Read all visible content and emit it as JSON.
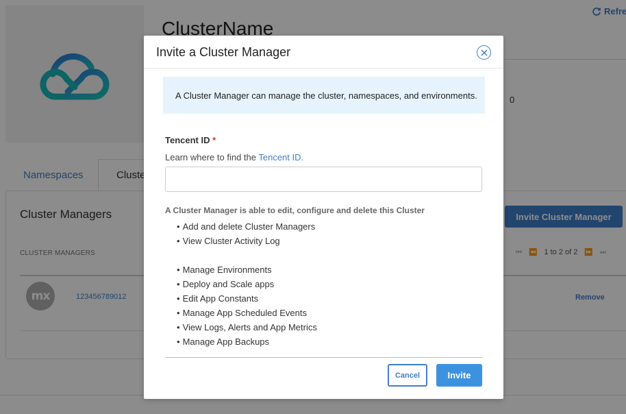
{
  "page": {
    "refresh_label": "Refre",
    "cluster_title": "ClusterName",
    "info_value": "0"
  },
  "tabs": [
    {
      "label": "Namespaces"
    },
    {
      "label": "Cluste"
    }
  ],
  "managers_panel": {
    "title": "Cluster Managers",
    "invite_button": "Invite Cluster Manager",
    "column_header": "CLUSTER MANAGERS",
    "pagination": "1 to 2 of 2",
    "rows": [
      {
        "avatar_text": "mx",
        "id": "123456789012",
        "action": "Remove"
      }
    ]
  },
  "modal": {
    "title": "Invite a Cluster Manager",
    "info_text": "A Cluster Manager can manage the cluster, namespaces, and environments.",
    "field_label": "Tencent ID",
    "required_mark": "*",
    "help_prefix": "Learn where to find the ",
    "help_link": "Tencent ID.",
    "input_value": "",
    "permissions_heading": "A Cluster Manager is able to edit, configure and delete this Cluster",
    "permissions_group1": [
      "Add and delete Cluster Managers",
      "View Cluster Activity Log"
    ],
    "permissions_group2": [
      "Manage Environments",
      "Deploy and Scale apps",
      "Edit App Constants",
      "Manage App Scheduled Events",
      "View Logs, Alerts and App Metrics",
      "Manage App Backups"
    ],
    "cancel_label": "Cancel",
    "invite_label": "Invite"
  },
  "colors": {
    "accent": "#3f7fc8",
    "info_bg": "#e6f3fc",
    "primary_button": "#3d92e0",
    "required": "#d8322a"
  }
}
